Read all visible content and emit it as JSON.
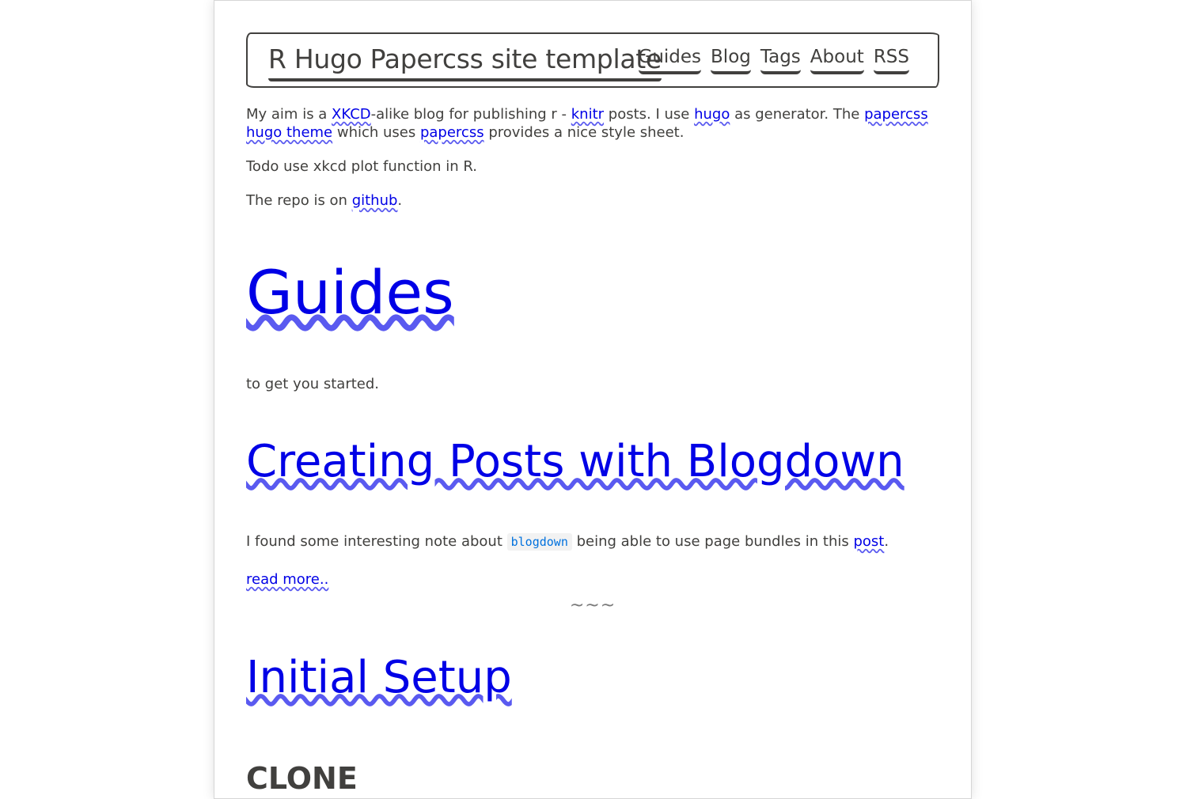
{
  "header": {
    "title": "R Hugo Papercss site template",
    "nav": [
      "Guides",
      "Blog",
      "Tags",
      "About",
      "RSS"
    ]
  },
  "intro": {
    "p1_a": "My aim is a ",
    "p1_xkcd": "XKCD",
    "p1_b": "-alike blog for publishing r - ",
    "p1_knitr": "knitr",
    "p1_c": " posts. I use ",
    "p1_hugo": "hugo",
    "p1_d": " as generator. The ",
    "p1_theme": "papercss hugo theme",
    "p1_e": " which uses ",
    "p1_papercss": "papercss",
    "p1_f": " provides a nice style sheet.",
    "p2": "Todo use xkcd plot function in R.",
    "p3_a": "The repo is on ",
    "p3_github": "github",
    "p3_b": "."
  },
  "section": {
    "title": "Guides",
    "description": "to get you started."
  },
  "post": {
    "title": "Creating Posts with Blogdown",
    "text_a": "I found some interesting note about ",
    "code": "blogdown",
    "text_b": " being able to use page bundles in this ",
    "post_link": "post",
    "text_c": ".",
    "read_more": "read more..",
    "separator": "~~~"
  },
  "next": {
    "title": "Initial Setup",
    "subheading": "CLONE"
  },
  "colors": {
    "link": "#0000e6",
    "text": "#41403e",
    "code": "#0071de"
  }
}
